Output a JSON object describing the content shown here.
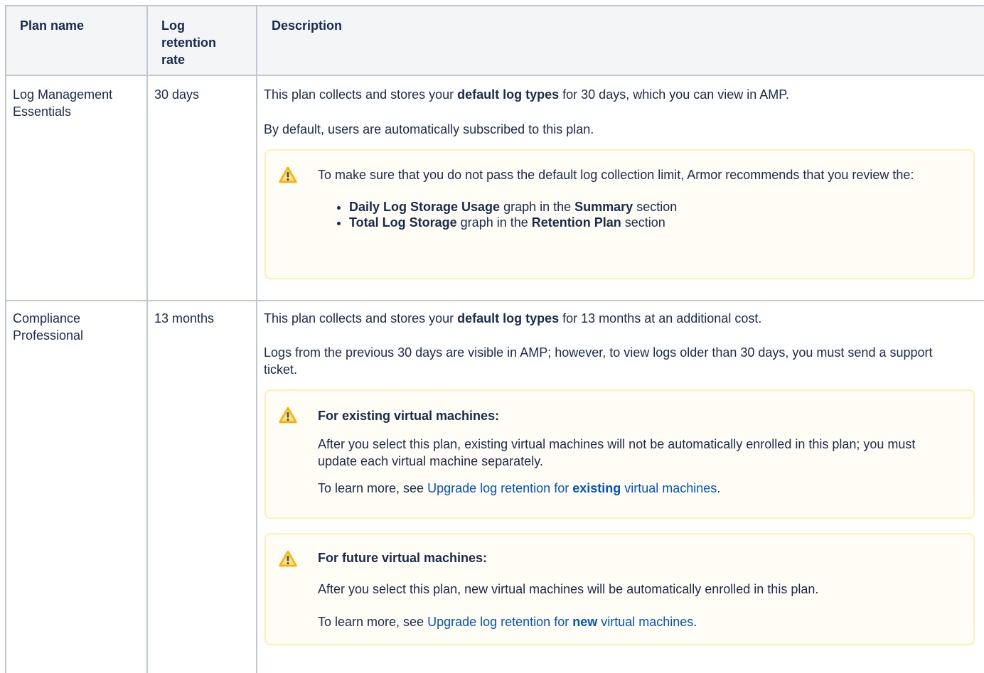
{
  "table": {
    "headers": {
      "plan_name": "Plan name",
      "log_retention_rate_1": "Log",
      "log_retention_rate_2": "retention",
      "log_retention_rate_3": "rate",
      "description": "Description"
    },
    "rows": [
      {
        "plan_name_1": "Log Management",
        "plan_name_2": "Essentials",
        "retention": "30 days",
        "p1": {
          "a": "This plan collects and stores your ",
          "b": "default log types",
          "c": " for 30 days, which you can view in AMP."
        },
        "p2": "By default, users are automatically subscribed to this plan.",
        "note": {
          "text": "To make sure that you do not pass the default log collection limit, Armor recommends that you review the:",
          "bullets": [
            {
              "a": "Daily Log Storage Usage",
              "b": " graph in the ",
              "c": "Summary",
              "d": " section"
            },
            {
              "a": "Total Log Storage",
              "b": " graph in the ",
              "c": "Retention Plan",
              "d": " section"
            }
          ]
        }
      },
      {
        "plan_name_1": "Compliance",
        "plan_name_2": "Professional",
        "retention": "13 months",
        "p1": {
          "a": "This plan collects and stores your ",
          "b": "default log types",
          "c": " for 13 months at an additional cost."
        },
        "p2": "Logs from the previous 30 days are visible in AMP; however, to view logs older than 30 days, you must send a support ticket.",
        "note_existing": {
          "title": "For existing virtual machines:",
          "text": "After you select this plan, existing virtual machines will not be automatically enrolled in this plan; you must update each virtual machine separately.",
          "learn_prefix": "To learn more, see ",
          "link_a": "Upgrade log retention for ",
          "link_b": "existing",
          "link_c": " virtual machines",
          "suffix": "."
        },
        "note_future": {
          "title": "For future virtual machines:",
          "text": "After you select this plan, new virtual machines will be automatically enrolled in this plan.",
          "learn_prefix": "To learn more, see ",
          "link_a": "Upgrade log retention for ",
          "link_b": "new",
          "link_c": " virtual machines",
          "suffix": "."
        }
      }
    ]
  },
  "colors": {
    "border": "#c1c7d0",
    "header_bg": "#f4f5f7",
    "note_bg": "#fffdf6",
    "note_border": "#fff0b3",
    "warning_icon": "#ffab00",
    "link": "#0052cc"
  },
  "icons": {
    "warning": "warning-icon"
  }
}
